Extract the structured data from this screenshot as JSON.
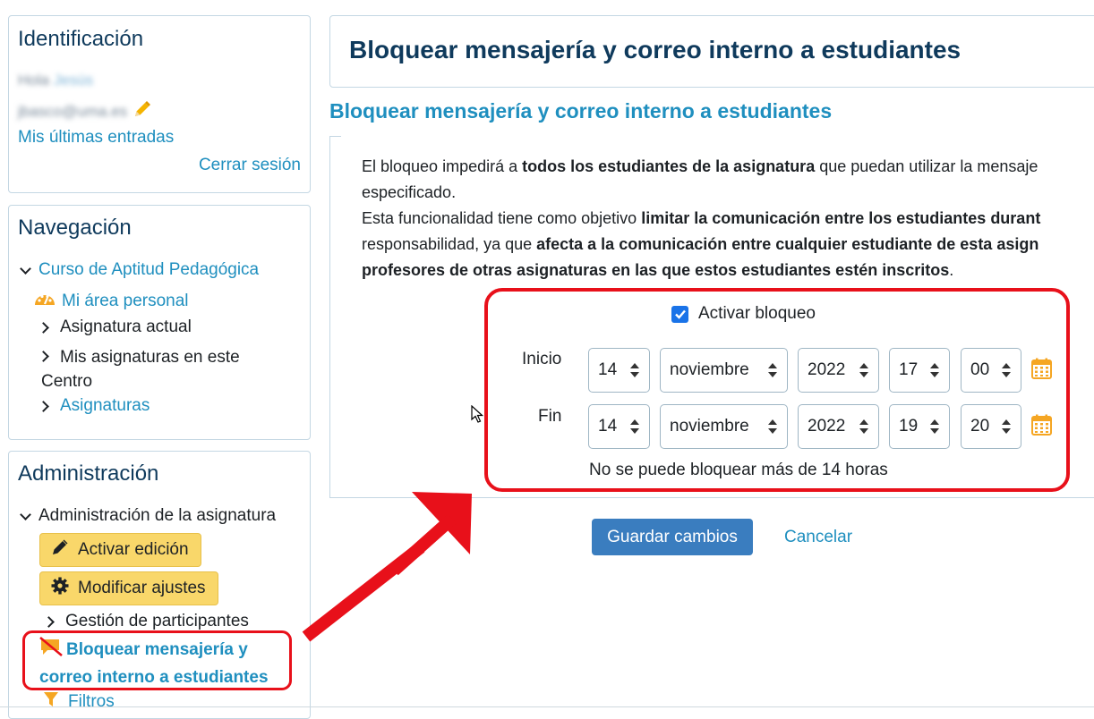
{
  "identificacion": {
    "title": "Identificación",
    "greeting": "Hola",
    "user_name": "Jesús",
    "email": "jbasco@uma.es",
    "mis_ultimas": "Mis últimas entradas",
    "cerrar_sesion": "Cerrar sesión"
  },
  "navegacion": {
    "title": "Navegación",
    "course": "Curso de Aptitud Pedagógica",
    "mi_area": "Mi área personal",
    "asignatura_actual": "Asignatura actual",
    "mis_asignaturas_1": "Mis asignaturas en este",
    "mis_asignaturas_2": "Centro",
    "asignaturas": "Asignaturas"
  },
  "administracion": {
    "title": "Administración",
    "admin_asignatura": "Administración de la asignatura",
    "activar_edicion": "Activar edición",
    "modificar_ajustes": "Modificar ajustes",
    "gestion_participantes": "Gestión de participantes",
    "bloquear_1": "Bloquear mensajería y",
    "bloquear_2": "correo interno a estudiantes",
    "filtros": "Filtros"
  },
  "main": {
    "page_title": "Bloquear mensajería y correo interno a estudiantes",
    "section_title": "Bloquear mensajería y correo interno a estudiantes",
    "p1_a": "El bloqueo impedirá a ",
    "p1_b": "todos los estudiantes de la asignatura",
    "p1_c": " que puedan utilizar la mensaje",
    "p1_d": "especificado.",
    "p2_a": "Esta funcionalidad tiene como objetivo ",
    "p2_b": "limitar la comunicación entre los estudiantes durant",
    "p2_c": "responsabilidad, ya que ",
    "p2_d": "afecta a la comunicación entre cualquier estudiante de esta asign",
    "p2_e": "profesores de otras asignaturas en las que estos estudiantes estén inscritos",
    "p2_f": "."
  },
  "form": {
    "activar_label": "Activar bloqueo",
    "activar_checked": true,
    "inicio_label": "Inicio",
    "fin_label": "Fin",
    "inicio": {
      "day": "14",
      "month": "noviembre",
      "year": "2022",
      "hour": "17",
      "minute": "00"
    },
    "fin": {
      "day": "14",
      "month": "noviembre",
      "year": "2022",
      "hour": "19",
      "minute": "20"
    },
    "note": "No se puede bloquear más de 14 horas",
    "save": "Guardar cambios",
    "cancel": "Cancelar"
  },
  "colors": {
    "accent_link": "#1f8fbf",
    "primary_button": "#3a7dbf",
    "highlight_red": "#e8101a",
    "title_dark": "#0f3a5c"
  }
}
